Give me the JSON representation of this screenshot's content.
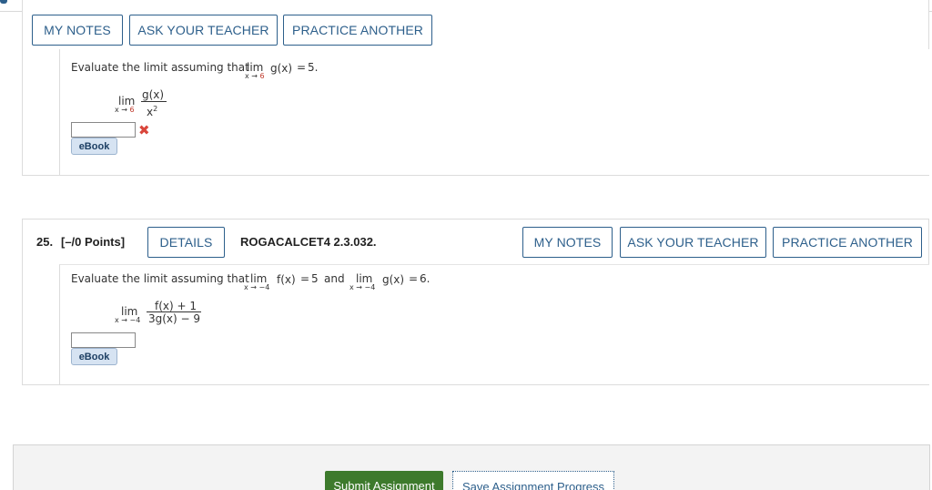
{
  "top_buttons": {
    "my_notes": "MY NOTES",
    "ask_teacher": "ASK YOUR TEACHER",
    "practice_another": "PRACTICE ANOTHER"
  },
  "q24": {
    "prompt_prefix": "Evaluate the limit assuming that",
    "given_lim": "lim",
    "given_func": "g(x)",
    "given_eq": "=",
    "given_value": "5.",
    "given_sub": "x → 6",
    "expr_lim": "lim",
    "expr_sub_x": "x →",
    "expr_sub_val": "6",
    "expr_num": "g(x)",
    "expr_den_base": "x",
    "expr_den_exp": "2",
    "answer_value": "",
    "result_mark": "✖",
    "ebook": "eBook"
  },
  "q25": {
    "number": "25.",
    "points": "[–/0 Points]",
    "details": "DETAILS",
    "code": "ROGACALCET4 2.3.032.",
    "my_notes": "MY NOTES",
    "ask_teacher": "ASK YOUR TEACHER",
    "practice_another": "PRACTICE ANOTHER",
    "prompt_prefix": "Evaluate the limit assuming that",
    "lim1": "lim",
    "f_func": "f(x)",
    "eq1": "=",
    "f_value": "5",
    "and": "and",
    "lim2": "lim",
    "g_func": "g(x)",
    "eq2": "=",
    "g_value": "6.",
    "sub1": "x → −4",
    "sub2": "x → −4",
    "expr_lim": "lim",
    "expr_sub": "x → −4",
    "expr_num": "f(x) + 1",
    "expr_den": "3g(x) − 9",
    "answer_value": "",
    "ebook": "eBook"
  },
  "footer": {
    "submit": "Submit Assignment",
    "save": "Save Assignment Progress"
  },
  "colors": {
    "accent": "#2d5f8b",
    "given_red": "#c0392b",
    "submit_green": "#3d7a2c",
    "ebook_bg": "#d6e3f2"
  }
}
